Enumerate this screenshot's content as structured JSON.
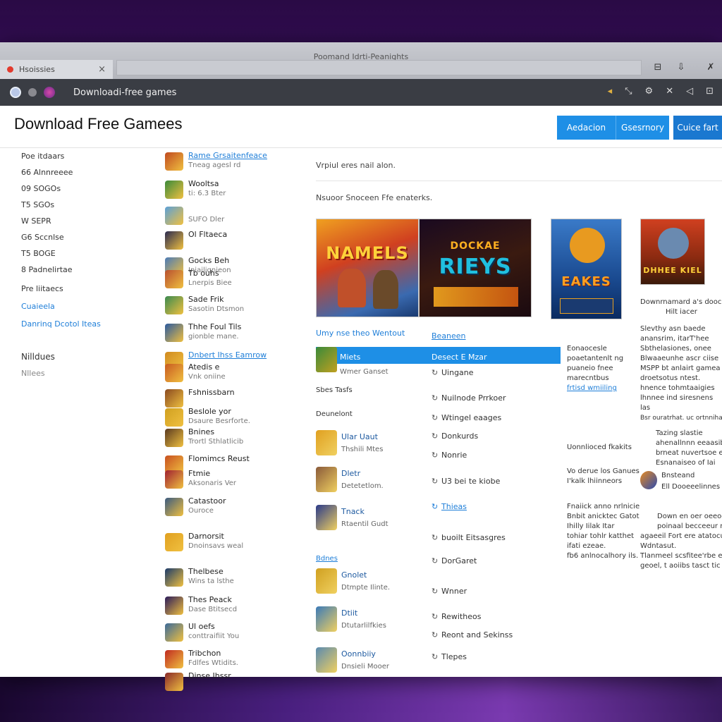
{
  "window": {
    "title": "Poomand Idrti-Peanights",
    "tab_label": "Hsoissies",
    "tab_close": "×"
  },
  "toolbar": {
    "title": "Downloadi-free games",
    "right_icons": [
      "◂",
      "⤡",
      "⚙",
      "✕",
      "◁",
      "⊡"
    ]
  },
  "header": {
    "page_title": "Download Free Gamees",
    "btn1": "Aedacion",
    "btn2": "Gsesrnory",
    "btn3": "Cuice fart"
  },
  "categories": {
    "items": [
      "Poe itdaars",
      "66 Alnnreeee",
      "09 SOGOs",
      "T5 SGOs",
      "W SEPR",
      "G6 Sccnlse",
      "T5 BOGE",
      "8 Padnelirtae",
      "Pre liitaecs"
    ],
    "link1": "Cuaieela",
    "link2": "Danrinq Dcotol Iteas",
    "section": "Nilldues",
    "sub": "Nllees"
  },
  "game_list": [
    {
      "t1": "Rame Grsaitenfeace",
      "t2": "Tneag agesl rd",
      "link": true,
      "color": "#c04a20"
    },
    {
      "t1": "Wooltsa",
      "t2": "ti: 6.3 Bter",
      "link": false,
      "color": "#3a8a3a"
    },
    {
      "t1": "",
      "t2": "SUFO Dler",
      "link": false,
      "color": "#5aa0d8"
    },
    {
      "t1": "Ol Fltaeca",
      "t2": "",
      "link": false,
      "color": "#2a2a50"
    },
    {
      "t1": "Gocks Beh",
      "t2": "Iniailiqnieon",
      "link": false,
      "color": "#4a7ab8"
    },
    {
      "t1": "Tb ouhs",
      "t2": "Lnerpis Biee",
      "link": false,
      "color": "#b85030"
    },
    {
      "t1": "Sade Frik",
      "t2": "Sasotin Dtsmon",
      "link": false,
      "color": "#3a8a50"
    },
    {
      "t1": "Thhe Foul Tils",
      "t2": "gionble mane.",
      "link": false,
      "color": "#2a5aa0"
    },
    {
      "t1": "Dnbert Ihss Eamrow",
      "t2": "",
      "link": true,
      "color": "#d08a20"
    },
    {
      "t1": "Atedis e",
      "t2": "Vnk oniine",
      "link": false,
      "color": "#c85a20"
    },
    {
      "t1": "Fshnissbarn",
      "t2": "",
      "link": false,
      "color": "#8a4a20"
    },
    {
      "t1": "Beslole yor",
      "t2": "Dsaure Besrforte.",
      "link": false,
      "color": "#d0a020"
    },
    {
      "t1": "Bnines",
      "t2": "Trortl Sthlatlicib",
      "link": false,
      "color": "#5a3a20"
    },
    {
      "t1": "Flomimcs Reust",
      "t2": "",
      "link": false,
      "color": "#c85020"
    },
    {
      "t1": "Ftmie",
      "t2": "Aksonaris Ver",
      "link": false,
      "color": "#a02030"
    },
    {
      "t1": "Catastoor",
      "t2": "Ouroce",
      "link": false,
      "color": "#3a5a80"
    },
    {
      "t1": "Darnorsit",
      "t2": "Dnoinsavs weal",
      "link": false,
      "color": "#e0a020"
    },
    {
      "t1": "Thelbese",
      "t2": "Wins ta lsthe",
      "link": false,
      "color": "#1a3a6a"
    },
    {
      "t1": "Thes Peack",
      "t2": "Dase Btitsecd",
      "link": false,
      "color": "#2a1a5a"
    },
    {
      "t1": "Ul oefs",
      "t2": "conttraifiit You",
      "link": false,
      "color": "#3a6a9a"
    },
    {
      "t1": "Tribchon",
      "t2": "Fdlfes Wtidits.",
      "link": false,
      "color": "#c02a20"
    },
    {
      "t1": "Dinse Ihssr",
      "t2": "",
      "link": false,
      "color": "#8a2a2a"
    }
  ],
  "main": {
    "line1": "Vrpiul eres nail alon.",
    "line2": "Nsuoor Snoceen Ffe enaterks.",
    "banner1": "NAMELS",
    "banner2": "RIEYS",
    "banner2_sub": "DOCKAE",
    "banner3": "EAKES",
    "banner4": "DHHEE KIEL",
    "section_head": "Umy nse theo Wentout",
    "section_link": "Beaneen",
    "selected_left": "Miets",
    "selected_left_sub": "Wmer Ganset",
    "selected_right": "Desect E Mzar",
    "items_mid": [
      "Uingane",
      "Nuilnode Prrkoer",
      "Wtingel eaages",
      "Donkurds",
      "Nonrie",
      "U3 bei te kiobe",
      "Thieas",
      "buoilt Eitsasgres",
      "DorGaret",
      "Wnner",
      "Rewitheos",
      "Reont and Sekinss",
      "Tlepes"
    ],
    "labels_left": [
      "Sbes Tasfs",
      "Deunelont",
      "Bdnes"
    ],
    "games_left": [
      {
        "t1": "Ular Uaut",
        "t2": "Thshili Mtes",
        "color": "#e0a020"
      },
      {
        "t1": "Dletr",
        "t2": "Detetetlom.",
        "color": "#8a5a3a"
      },
      {
        "t1": "Tnack",
        "t2": "Rtaentil Gudt",
        "color": "#2a3a8a"
      },
      {
        "t1": "Gnolet",
        "t2": "Dtmpte Ilinte.",
        "color": "#d0a020"
      },
      {
        "t1": "Dtiit",
        "t2": "Dtutarlilfkies",
        "color": "#3a7ab8"
      },
      {
        "t1": "Oonnbiiy",
        "t2": "Dnsieli Mooer",
        "color": "#5a8ab0"
      }
    ],
    "right1": [
      "Eonaocesle",
      "poaetantenlt ng",
      "puaneio fnee",
      "marecntbus",
      "frtisd wmiiling"
    ],
    "right2": "Uonnlioced fkakits",
    "right3": [
      "Vo derue los Ganues",
      "I'kalk lhiinneors"
    ],
    "right4": [
      "Fnaiick anno nrlnicie",
      "Bnbit anicktec Gatot",
      "Ihilly Iilak Itar",
      "tohiar tohlr katthet",
      "ifati ezeae.",
      "fb6 anlnocalhory ils."
    ],
    "far_right1": [
      "Downrnamard a's dooc",
      "Hilt iacer"
    ],
    "far_right2": [
      "Slevthy asn baede",
      "anansrim, itarT'hee",
      "Sbthelasiones, onee",
      "Blwaaeunhe ascr ciise",
      "MSPP bt anlairt gamea",
      "droetsotus ntest.",
      "hnence tohmtaaigies",
      "lhnnee ind siresnens",
      "las"
    ],
    "far_right3": "Bsr ouratrhat. uc ortnnihatia",
    "far_right4": [
      "Tazing slastie",
      "ahenallnnn eeaasiba",
      "brneat nuvertsoe e",
      "Esnanaiseo of Iai"
    ],
    "far_right_game": {
      "t1": "Bnsteand",
      "t2": "Ell Dooeeelinnes"
    },
    "far_right5": [
      "Down en oer oeeoo",
      "poinaal becceeur nee",
      "agaeeil Fort ere atatocui",
      "Wdntasut.",
      "Tlanmeel scsfitee'rbe ee",
      "geoel, t aoiibs tasct tic"
    ]
  },
  "colors": {
    "accent": "#1e8fe6",
    "selected_row": "#1e8fe6",
    "link": "#1e7ed8",
    "toolbar_bg": "#3a3d44"
  }
}
